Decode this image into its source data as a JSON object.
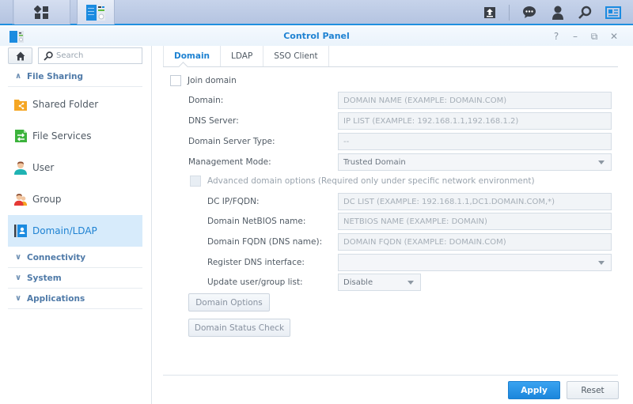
{
  "taskbar": {
    "left_icons": [
      "main-menu-icon",
      "control-panel-app-icon"
    ],
    "right_icons": [
      "upload-queue-icon",
      "notifications-icon",
      "user-options-icon",
      "search-icon",
      "widgets-icon"
    ]
  },
  "window": {
    "title": "Control Panel",
    "controls": {
      "help": "?",
      "minimize": "–",
      "restore": "⧉",
      "close": "✕"
    }
  },
  "sidebar": {
    "search_placeholder": "Search",
    "groups": [
      {
        "label": "File Sharing",
        "expanded": true
      },
      {
        "label": "Connectivity",
        "expanded": false
      },
      {
        "label": "System",
        "expanded": false
      },
      {
        "label": "Applications",
        "expanded": false
      }
    ],
    "items": [
      {
        "label": "Shared Folder",
        "icon": "shared-folder-icon"
      },
      {
        "label": "File Services",
        "icon": "file-services-icon"
      },
      {
        "label": "User",
        "icon": "user-icon"
      },
      {
        "label": "Group",
        "icon": "group-icon"
      },
      {
        "label": "Domain/LDAP",
        "icon": "domain-ldap-icon",
        "active": true
      }
    ]
  },
  "tabs": [
    {
      "label": "Domain",
      "active": true
    },
    {
      "label": "LDAP",
      "active": false
    },
    {
      "label": "SSO Client",
      "active": false
    }
  ],
  "form": {
    "join_domain": {
      "label": "Join domain",
      "checked": false
    },
    "domain": {
      "label": "Domain:",
      "placeholder": "DOMAIN NAME (EXAMPLE: DOMAIN.COM)",
      "value": ""
    },
    "dns_server": {
      "label": "DNS Server:",
      "placeholder": "IP LIST (EXAMPLE: 192.168.1.1,192.168.1.2)",
      "value": ""
    },
    "domain_server_type": {
      "label": "Domain Server Type:",
      "value": "--"
    },
    "management_mode": {
      "label": "Management Mode:",
      "value": "Trusted Domain"
    },
    "advanced": {
      "label": "Advanced domain options (Required only under specific network environment)",
      "checked": false
    },
    "dc_ip": {
      "label": "DC IP/FQDN:",
      "placeholder": "DC LIST (EXAMPLE: 192.168.1.1,DC1.DOMAIN.COM,*)",
      "value": ""
    },
    "netbios": {
      "label": "Domain NetBIOS name:",
      "placeholder": "NETBIOS NAME (EXAMPLE: DOMAIN)",
      "value": ""
    },
    "fqdn": {
      "label": "Domain FQDN (DNS name):",
      "placeholder": "DOMAIN FQDN (EXAMPLE: DOMAIN.COM)",
      "value": ""
    },
    "register_dns": {
      "label": "Register DNS interface:",
      "value": ""
    },
    "update_list": {
      "label": "Update user/group list:",
      "value": "Disable"
    },
    "domain_options_button": "Domain Options",
    "domain_status_button": "Domain Status Check"
  },
  "footer": {
    "apply": "Apply",
    "reset": "Reset"
  },
  "colors": {
    "accent": "#1e82d2",
    "active_nav_bg": "#d7ebfb",
    "apply_button": "#2495e6"
  }
}
